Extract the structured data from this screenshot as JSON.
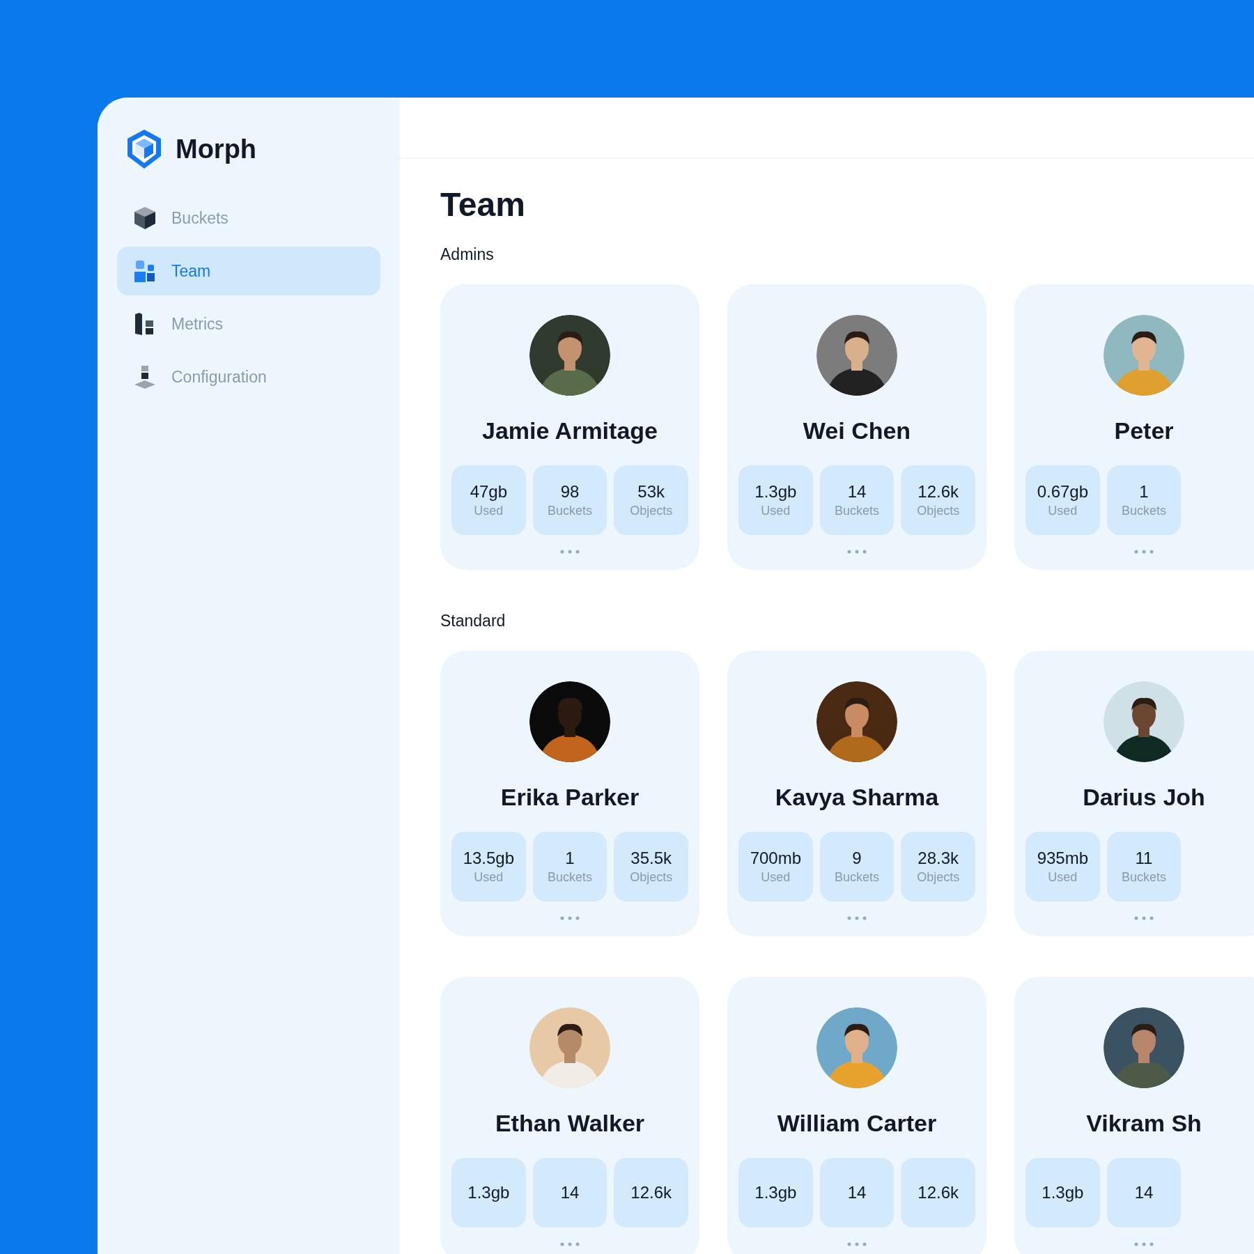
{
  "brand": "Morph",
  "nav": [
    {
      "label": "Buckets",
      "selected": false
    },
    {
      "label": "Team",
      "selected": true
    },
    {
      "label": "Metrics",
      "selected": false
    },
    {
      "label": "Configuration",
      "selected": false
    }
  ],
  "title": "Team",
  "sections": [
    {
      "heading": "Admins",
      "members": [
        {
          "name": "Jamie Armitage",
          "stats": [
            {
              "value": "47gb",
              "label": "Used"
            },
            {
              "value": "98",
              "label": "Buckets"
            },
            {
              "value": "53k",
              "label": "Objects"
            }
          ]
        },
        {
          "name": "Wei Chen",
          "stats": [
            {
              "value": "1.3gb",
              "label": "Used"
            },
            {
              "value": "14",
              "label": "Buckets"
            },
            {
              "value": "12.6k",
              "label": "Objects"
            }
          ]
        },
        {
          "name": "Peter",
          "stats": [
            {
              "value": "0.67gb",
              "label": "Used"
            },
            {
              "value": "1",
              "label": "Buckets"
            }
          ]
        }
      ]
    },
    {
      "heading": "Standard",
      "members": [
        {
          "name": "Erika Parker",
          "stats": [
            {
              "value": "13.5gb",
              "label": "Used"
            },
            {
              "value": "1",
              "label": "Buckets"
            },
            {
              "value": "35.5k",
              "label": "Objects"
            }
          ]
        },
        {
          "name": "Kavya Sharma",
          "stats": [
            {
              "value": "700mb",
              "label": "Used"
            },
            {
              "value": "9",
              "label": "Buckets"
            },
            {
              "value": "28.3k",
              "label": "Objects"
            }
          ]
        },
        {
          "name": "Darius Joh",
          "stats": [
            {
              "value": "935mb",
              "label": "Used"
            },
            {
              "value": "11",
              "label": "Buckets"
            }
          ]
        },
        {
          "name": "Ethan Walker",
          "stats": [
            {
              "value": "1.3gb"
            },
            {
              "value": "14"
            },
            {
              "value": "12.6k"
            }
          ]
        },
        {
          "name": "William Carter",
          "stats": [
            {
              "value": "1.3gb"
            },
            {
              "value": "14"
            },
            {
              "value": "12.6k"
            }
          ]
        },
        {
          "name": "Vikram Sh",
          "stats": [
            {
              "value": "1.3gb"
            },
            {
              "value": "14"
            }
          ]
        }
      ]
    }
  ]
}
